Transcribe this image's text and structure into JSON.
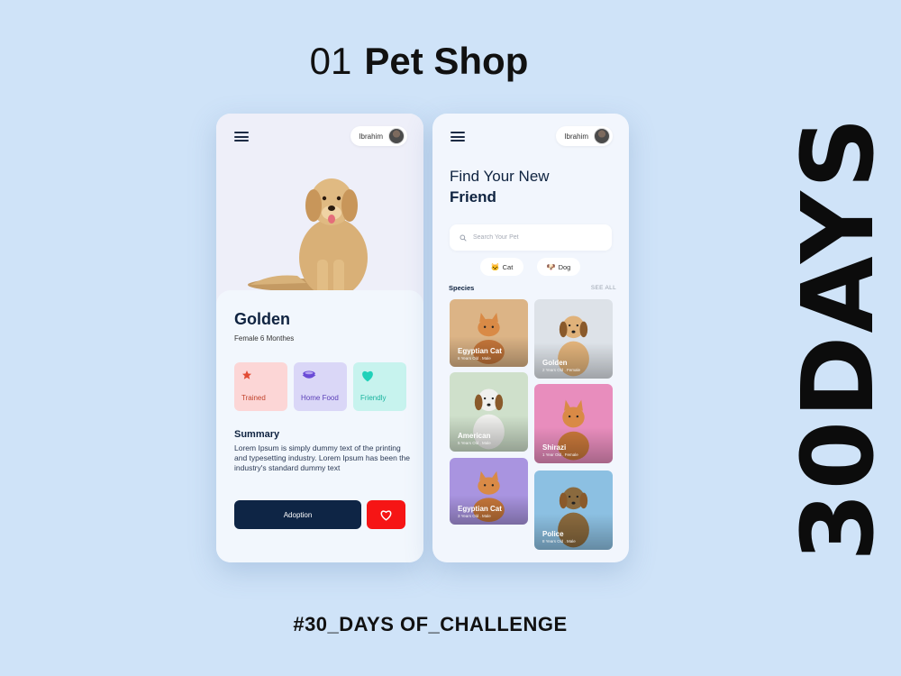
{
  "header": {
    "number": "01",
    "title": "Pet Shop"
  },
  "side_text": "30DAYS",
  "footer": {
    "hashtag": "#30_DAYS OF_CHALLENGE"
  },
  "detail": {
    "user": "Ibrahim",
    "pet": {
      "name": "Golden",
      "meta": "Female  6 Monthes"
    },
    "features": [
      {
        "label": "Trained",
        "icon": "star-icon",
        "color": "#e24b34"
      },
      {
        "label": "Home Food",
        "icon": "food-bowl-icon",
        "color": "#6a4bd6"
      },
      {
        "label": "Friendly",
        "icon": "heart-icon",
        "color": "#1fd1b9"
      }
    ],
    "summary_title": "Summary",
    "summary_text": "Lorem Ipsum is simply dummy text of the printing and typesetting industry. Lorem Ipsum has been the industry's standard dummy text",
    "adopt_label": "Adoption",
    "colors": {
      "primary": "#0e2545",
      "favorite": "#f61515"
    }
  },
  "list": {
    "user": "Ibrahim",
    "title_line1": "Find Your New",
    "title_line2": "Friend",
    "search_placeholder": "Search Your Pet",
    "filters": [
      {
        "label": "Cat",
        "icon": "cat-icon"
      },
      {
        "label": "Dog",
        "icon": "dog-icon"
      }
    ],
    "species_label": "Species",
    "see_all": "SEE ALL",
    "cards": [
      {
        "name": "Egyptian Cat",
        "meta": "6 Years Old . Male",
        "bg": "#dcb486",
        "animal": "cat"
      },
      {
        "name": "Golden",
        "meta": "2 Years Old . Female",
        "bg": "#dde2e8",
        "animal": "dog"
      },
      {
        "name": "American",
        "meta": "5 Years Old . Male",
        "bg": "#cfe0cb",
        "animal": "dog"
      },
      {
        "name": "Shirazi",
        "meta": "1 Year Old . Female",
        "bg": "#e88dbd",
        "animal": "cat"
      },
      {
        "name": "Egyptian Cat",
        "meta": "3 Years Old . Male",
        "bg": "#a994e0",
        "animal": "cat"
      },
      {
        "name": "Police",
        "meta": "8 Years Old . Male",
        "bg": "#8cc0e2",
        "animal": "dog"
      }
    ]
  }
}
